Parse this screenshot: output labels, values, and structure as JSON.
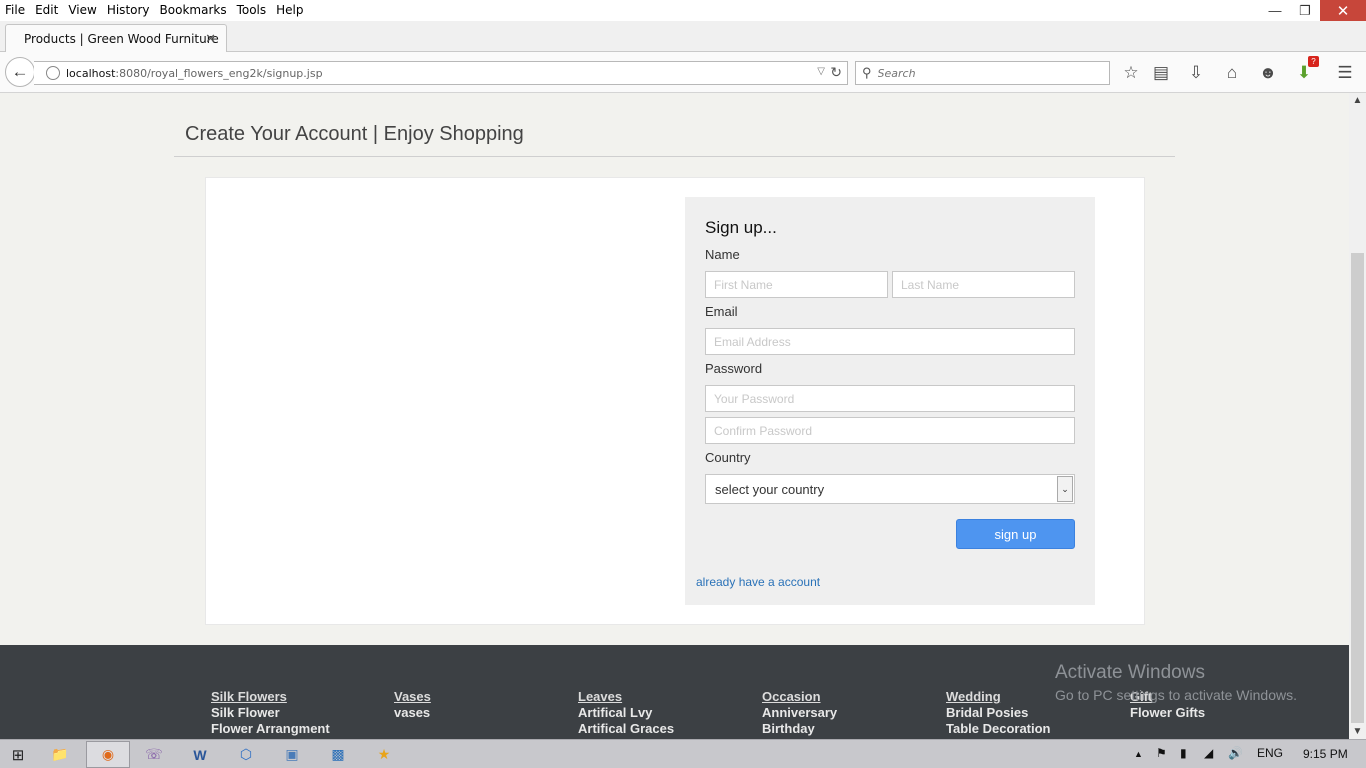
{
  "browser": {
    "menu": [
      "File",
      "Edit",
      "View",
      "History",
      "Bookmarks",
      "Tools",
      "Help"
    ],
    "tab_title": "Products | Green Wood Furniture",
    "url_host": "localhost",
    "url_path": ":8080/royal_flowers_eng2k/signup.jsp",
    "search_placeholder": "Search",
    "download_badge": "?"
  },
  "page": {
    "title": "Create Your Account | Enjoy Shopping"
  },
  "form": {
    "heading": "Sign up...",
    "name_label": "Name",
    "first_name_placeholder": "First Name",
    "last_name_placeholder": "Last Name",
    "email_label": "Email",
    "email_placeholder": "Email Address",
    "password_label": "Password",
    "password_placeholder": "Your Password",
    "confirm_placeholder": "Confirm Password",
    "country_label": "Country",
    "country_selected": "select your country",
    "submit_label": "sign up",
    "login_link": "already have a account"
  },
  "footer": {
    "columns": [
      {
        "heading": "Silk Flowers",
        "items": [
          "Silk Flower",
          "Flower Arrangment"
        ]
      },
      {
        "heading": "Vases",
        "items": [
          "vases"
        ]
      },
      {
        "heading": "Leaves",
        "items": [
          "Artifical Lvy",
          "Artifical Graces"
        ]
      },
      {
        "heading": "Occasion",
        "items": [
          "Anniversary",
          "Birthday"
        ]
      },
      {
        "heading": "Wedding",
        "items": [
          "Bridal Posies",
          "Table Decoration"
        ]
      },
      {
        "heading": "Gift",
        "items": [
          "Flower Gifts"
        ]
      }
    ],
    "activate_title": "Activate Windows",
    "activate_sub": "Go to PC settings to activate Windows."
  },
  "taskbar": {
    "language": "ENG",
    "time": "9:15 PM"
  },
  "colors": {
    "accent_button": "#4e95f0",
    "link": "#2a72b8",
    "footer_bg": "#3c4044",
    "close_button": "#c7463a"
  }
}
